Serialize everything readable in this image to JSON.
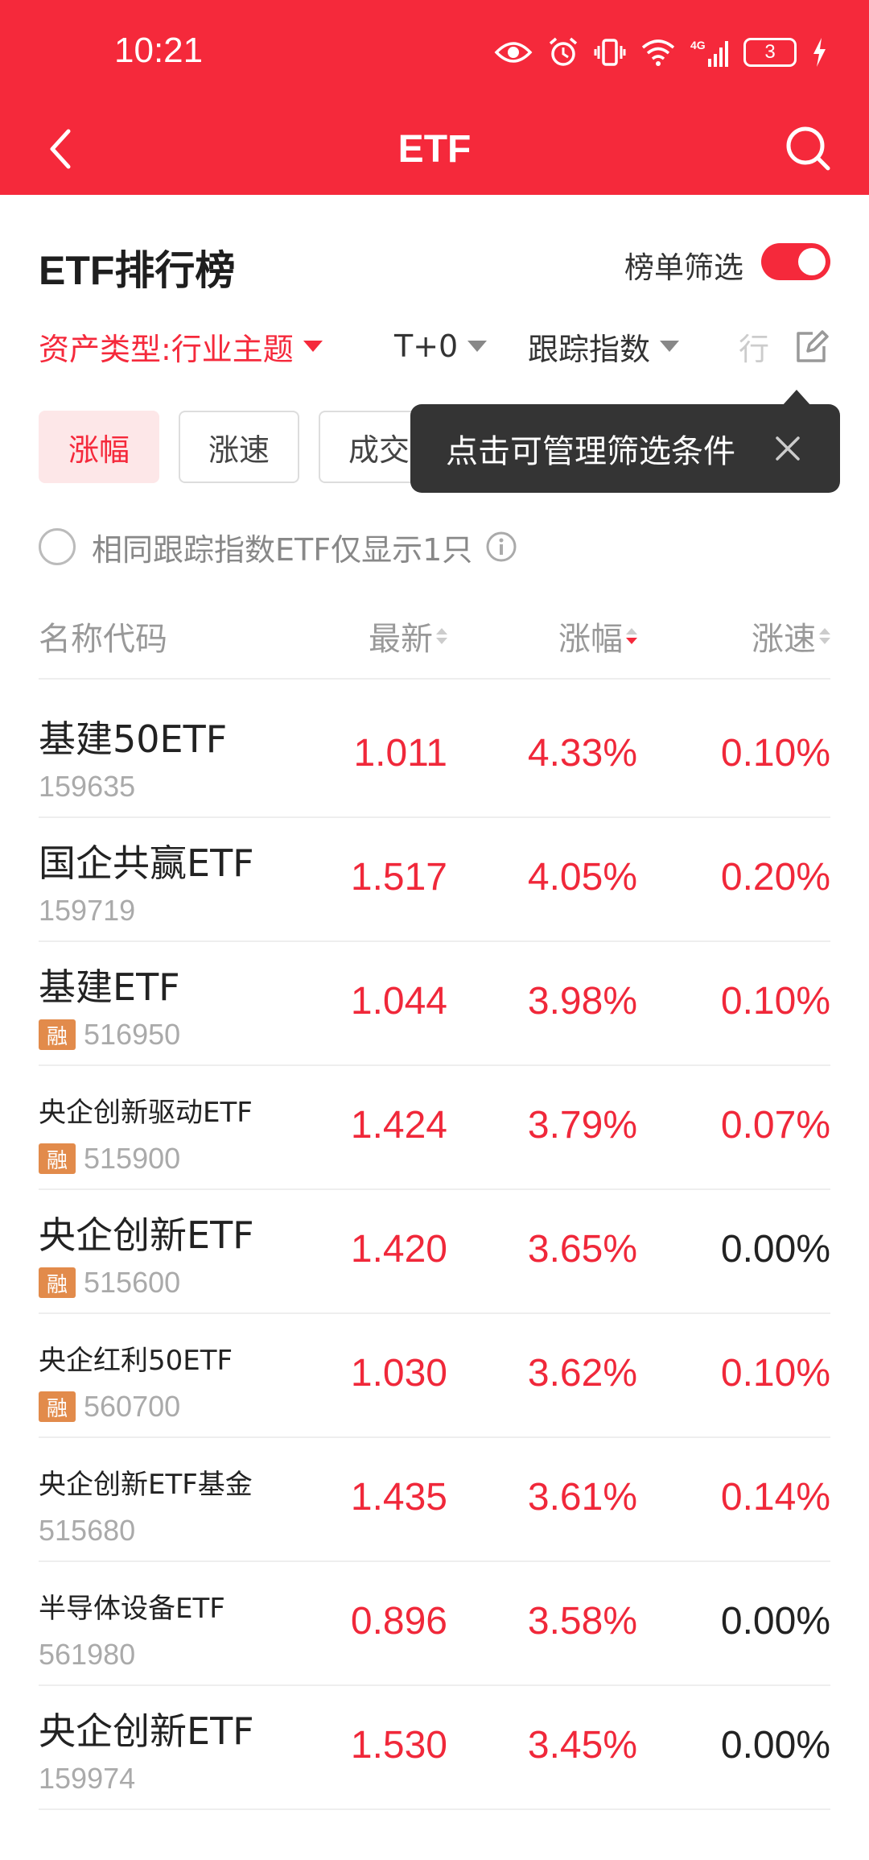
{
  "status_bar": {
    "time": "10:21",
    "battery": "3",
    "network": "4G"
  },
  "nav": {
    "title": "ETF"
  },
  "section": {
    "title": "ETF排行榜",
    "filter_toggle_label": "榜单筛选",
    "filter_toggle_on": true
  },
  "filters": [
    {
      "label": "资产类型:行业主题",
      "active": true
    },
    {
      "label": "T+0",
      "active": false
    },
    {
      "label": "跟踪指数",
      "active": false
    },
    {
      "label": "行",
      "active": false
    }
  ],
  "chips": [
    {
      "label": "涨幅",
      "active": true
    },
    {
      "label": "涨速",
      "active": false
    },
    {
      "label": "成交",
      "active": false
    }
  ],
  "tooltip": {
    "text": "点击可管理筛选条件"
  },
  "dedup": {
    "label": "相同跟踪指数ETF仅显示1只",
    "checked": false
  },
  "table": {
    "headers": {
      "name": "名称代码",
      "price": "最新",
      "change": "涨幅",
      "speed": "涨速"
    },
    "rows": [
      {
        "name": "基建50ETF",
        "code": "159635",
        "margin": false,
        "price": "1.011",
        "change": "4.33%",
        "speed": "0.10%",
        "speed_up": true,
        "small": false
      },
      {
        "name": "国企共赢ETF",
        "code": "159719",
        "margin": false,
        "price": "1.517",
        "change": "4.05%",
        "speed": "0.20%",
        "speed_up": true,
        "small": false
      },
      {
        "name": "基建ETF",
        "code": "516950",
        "margin": true,
        "price": "1.044",
        "change": "3.98%",
        "speed": "0.10%",
        "speed_up": true,
        "small": false
      },
      {
        "name": "央企创新驱动ETF",
        "code": "515900",
        "margin": true,
        "price": "1.424",
        "change": "3.79%",
        "speed": "0.07%",
        "speed_up": true,
        "small": true
      },
      {
        "name": "央企创新ETF",
        "code": "515600",
        "margin": true,
        "price": "1.420",
        "change": "3.65%",
        "speed": "0.00%",
        "speed_up": false,
        "small": false
      },
      {
        "name": "央企红利50ETF",
        "code": "560700",
        "margin": true,
        "price": "1.030",
        "change": "3.62%",
        "speed": "0.10%",
        "speed_up": true,
        "small": true
      },
      {
        "name": "央企创新ETF基金",
        "code": "515680",
        "margin": false,
        "price": "1.435",
        "change": "3.61%",
        "speed": "0.14%",
        "speed_up": true,
        "small": true
      },
      {
        "name": "半导体设备ETF",
        "code": "561980",
        "margin": false,
        "price": "0.896",
        "change": "3.58%",
        "speed": "0.00%",
        "speed_up": false,
        "small": true
      },
      {
        "name": "央企创新ETF",
        "code": "159974",
        "margin": false,
        "price": "1.530",
        "change": "3.45%",
        "speed": "0.00%",
        "speed_up": false,
        "small": false
      }
    ],
    "margin_badge": "融"
  },
  "icons": {
    "back": "chevron-left-icon",
    "search": "search-icon",
    "edit": "edit-icon",
    "close": "close-icon",
    "info": "info-icon"
  },
  "colors": {
    "brand": "#f5293b",
    "up": "#f0283a",
    "flat": "#222222",
    "margin_badge": "#e28b4b"
  }
}
